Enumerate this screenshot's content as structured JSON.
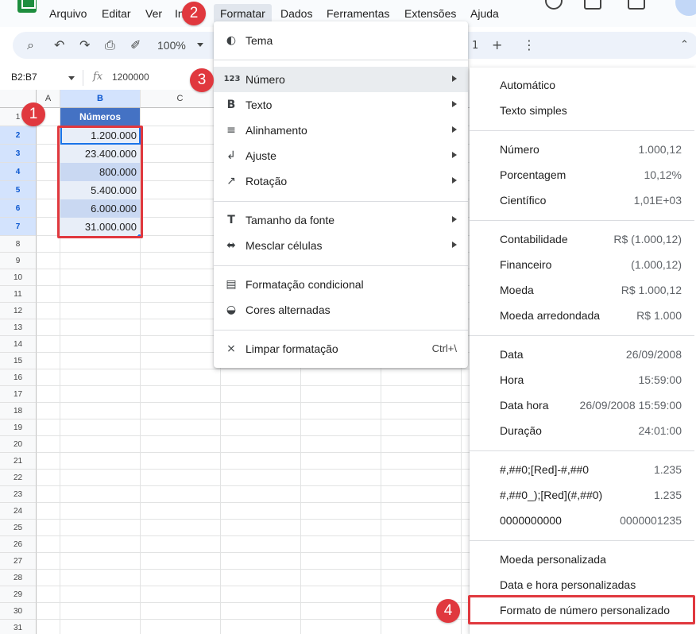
{
  "menubar": {
    "items": [
      "Arquivo",
      "Editar",
      "Ver",
      "In",
      "Formatar",
      "Dados",
      "Ferramentas",
      "Extensões",
      "Ajuda"
    ],
    "active": "Formatar"
  },
  "toolbar": {
    "zoom": "100%",
    "sheet_partial": "1"
  },
  "formula": {
    "range": "B2:B7",
    "fx": "fx",
    "value": "1200000"
  },
  "grid": {
    "columns": [
      "A",
      "B",
      "C"
    ],
    "rows": [
      "1",
      "2",
      "3",
      "4",
      "5",
      "6",
      "7",
      "8",
      "9",
      "10",
      "11",
      "12",
      "13",
      "14",
      "15",
      "16",
      "17",
      "18",
      "19",
      "20",
      "21",
      "22",
      "23",
      "24",
      "25",
      "26",
      "27",
      "28",
      "29",
      "30",
      "31"
    ],
    "header_cell": "Números",
    "values": [
      "1.200.000",
      "23.400.000",
      "800.000",
      "5.400.000",
      "6.000.000",
      "31.000.000"
    ]
  },
  "badges": [
    "1",
    "2",
    "3",
    "4"
  ],
  "format_menu": {
    "items": [
      {
        "label": "Tema",
        "icon": "palette-icon"
      },
      {
        "label": "Número",
        "icon": "number-format-icon"
      },
      {
        "label": "Texto",
        "icon": "bold-icon"
      },
      {
        "label": "Alinhamento",
        "icon": "align-left-icon"
      },
      {
        "label": "Ajuste",
        "icon": "text-wrap-icon"
      },
      {
        "label": "Rotação",
        "icon": "text-rotation-icon"
      },
      {
        "label": "Tamanho da fonte",
        "icon": "font-size-icon"
      },
      {
        "label": "Mesclar células",
        "icon": "merge-cells-icon"
      },
      {
        "label": "Formatação condicional",
        "icon": "paint-roller-icon"
      },
      {
        "label": "Cores alternadas",
        "icon": "color-drop-icon"
      },
      {
        "label": "Limpar formatação",
        "icon": "clear-format-icon"
      }
    ],
    "number_icon_text": "123",
    "clear_shortcut": "Ctrl+\\"
  },
  "number_menu": {
    "items": [
      {
        "label": "Automático",
        "sample": ""
      },
      {
        "label": "Texto simples",
        "sample": ""
      },
      {
        "label": "Número",
        "sample": "1.000,12"
      },
      {
        "label": "Porcentagem",
        "sample": "10,12%"
      },
      {
        "label": "Científico",
        "sample": "1,01E+03"
      },
      {
        "label": "Contabilidade",
        "sample": "R$ (1.000,12)"
      },
      {
        "label": "Financeiro",
        "sample": "(1.000,12)"
      },
      {
        "label": "Moeda",
        "sample": "R$ 1.000,12"
      },
      {
        "label": "Moeda arredondada",
        "sample": "R$ 1.000"
      },
      {
        "label": "Data",
        "sample": "26/09/2008"
      },
      {
        "label": "Hora",
        "sample": "15:59:00"
      },
      {
        "label": "Data hora",
        "sample": "26/09/2008 15:59:00"
      },
      {
        "label": "Duração",
        "sample": "24:01:00"
      },
      {
        "label": "#,##0;[Red]-#,##0",
        "sample": "1.235"
      },
      {
        "label": "#,##0_);[Red](#,##0)",
        "sample": "1.235"
      },
      {
        "label": "0000000000",
        "sample": "0000001235"
      },
      {
        "label": "Moeda personalizada",
        "sample": ""
      },
      {
        "label": "Data e hora personalizadas",
        "sample": ""
      },
      {
        "label": "Formato de número personalizado",
        "sample": ""
      }
    ]
  },
  "colors": {
    "accent": "#1a73e8",
    "header_fill": "#4472c4",
    "callout_red": "#e0383e",
    "cell_light": "#e8eef8",
    "cell_dark": "#c9d8f2"
  }
}
